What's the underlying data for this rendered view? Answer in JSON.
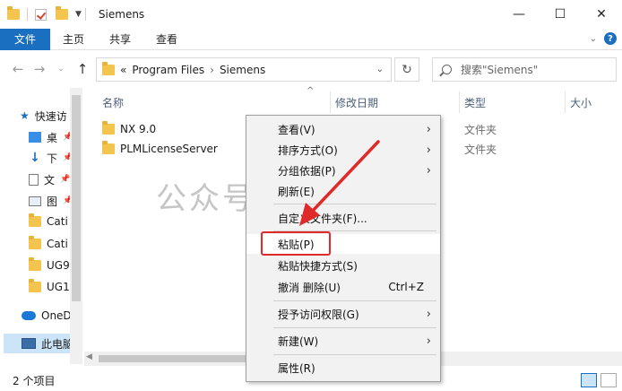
{
  "window": {
    "title": "Siemens",
    "minimize": "—",
    "maximize": "☐",
    "close": "✕"
  },
  "ribbon": {
    "file": "文件",
    "tabs": [
      "主页",
      "共享",
      "查看"
    ]
  },
  "address": {
    "path_prefix": "«",
    "path": [
      "Program Files",
      "Siemens"
    ],
    "search_placeholder": "搜索\"Siemens\""
  },
  "nav_pane": {
    "items": [
      {
        "label": "快速访",
        "icon": "star-icon"
      },
      {
        "label": "桌",
        "icon": "desktop-icon"
      },
      {
        "label": "下",
        "icon": "download-icon"
      },
      {
        "label": "文",
        "icon": "document-icon"
      },
      {
        "label": "图",
        "icon": "picture-icon"
      },
      {
        "label": "Cati",
        "icon": "folder-icon"
      },
      {
        "label": "Cati",
        "icon": "folder-icon"
      },
      {
        "label": "UG9",
        "icon": "folder-icon"
      },
      {
        "label": "UG1",
        "icon": "folder-icon"
      },
      {
        "label": "OneD",
        "icon": "cloud-icon"
      },
      {
        "label": "此电脑",
        "icon": "pc-icon"
      }
    ]
  },
  "columns": {
    "name": "名称",
    "modified": "修改日期",
    "type": "类型",
    "size": "大小"
  },
  "files": [
    {
      "name": "NX 9.0",
      "type": "文件夹"
    },
    {
      "name": "PLMLicenseServer",
      "type": "文件夹"
    }
  ],
  "status": {
    "count": "2 个项目"
  },
  "watermark": "公众号：开源神器",
  "context_menu": {
    "items": [
      {
        "label": "查看(V)",
        "submenu": true
      },
      {
        "label": "排序方式(O)",
        "submenu": true
      },
      {
        "label": "分组依据(P)",
        "submenu": true
      },
      {
        "label": "刷新(E)",
        "submenu": false
      },
      {
        "label": "自定义文件夹(F)...",
        "submenu": false
      },
      {
        "label": "粘贴(P)",
        "submenu": false
      },
      {
        "label": "粘贴快捷方式(S)",
        "submenu": false
      },
      {
        "label": "撤消 删除(U)",
        "shortcut": "Ctrl+Z",
        "submenu": false
      },
      {
        "label": "授予访问权限(G)",
        "submenu": true
      },
      {
        "label": "新建(W)",
        "submenu": true
      },
      {
        "label": "属性(R)",
        "submenu": false
      }
    ]
  },
  "colors": {
    "accent": "#1a6fc1",
    "highlight_box": "#e02a2a",
    "arrow": "#e02a2a"
  }
}
